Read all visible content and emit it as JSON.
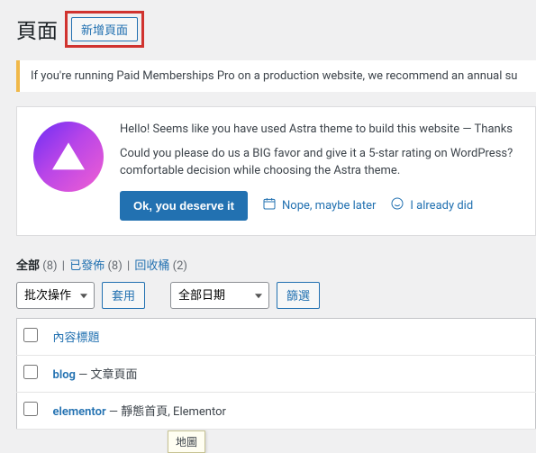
{
  "header": {
    "title": "頁面",
    "add_new_label": "新增頁面"
  },
  "notice": {
    "text": "If you're running Paid Memberships Pro on a production website, we recommend an annual su"
  },
  "astra_panel": {
    "greeting": "Hello! Seems like you have used Astra theme to build this website — Thanks",
    "ask": "Could you please do us a BIG favor and give it a 5-star rating on WordPress? comfortable decision while choosing the Astra theme.",
    "primary_btn": "Ok, you deserve it",
    "later_btn": "Nope, maybe later",
    "already_btn": "I already did"
  },
  "subsubsub": {
    "all": {
      "label": "全部",
      "count": "8"
    },
    "published": {
      "label": "已發佈",
      "count": "8"
    },
    "trash": {
      "label": "回收桶",
      "count": "2"
    }
  },
  "filters": {
    "bulk_action": "批次操作",
    "apply": "套用",
    "all_dates": "全部日期",
    "filter": "篩選"
  },
  "table": {
    "col_title": "內容標題",
    "rows": [
      {
        "title": "blog",
        "suffix": " — 文章頁面"
      },
      {
        "title": "elementor",
        "suffix": " — 靜態首頁, Elementor"
      }
    ]
  },
  "tooltip": "地圖"
}
